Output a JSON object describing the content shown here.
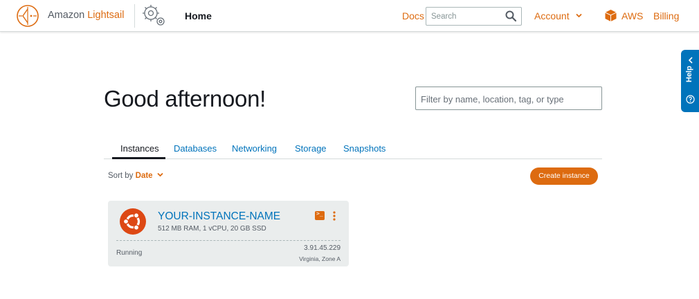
{
  "header": {
    "brand_prefix": "Amazon ",
    "brand_name": "Lightsail",
    "home_label": "Home",
    "docs_label": "Docs",
    "search_placeholder": "Search",
    "account_label": "Account",
    "aws_label": "AWS",
    "billing_label": "Billing",
    "accent_color": "#dd6b10"
  },
  "help_tab": {
    "label": "Help",
    "color": "#0073bb"
  },
  "main": {
    "greeting": "Good afternoon!",
    "filter_placeholder": "Filter by name, location, tag, or type",
    "tabs": [
      {
        "label": "Instances",
        "active": true
      },
      {
        "label": "Databases",
        "active": false
      },
      {
        "label": "Networking",
        "active": false
      },
      {
        "label": "Storage",
        "active": false
      },
      {
        "label": "Snapshots",
        "active": false
      }
    ],
    "sort_label": "Sort by",
    "sort_value": "Date",
    "create_button": "Create instance"
  },
  "instance": {
    "name": "YOUR-INSTANCE-NAME",
    "specs": "512 MB RAM, 1 vCPU, 20 GB SSD",
    "status": "Running",
    "ip": "3.91.45.229",
    "zone": "Virginia, Zone A",
    "os_icon": "ubuntu-icon"
  }
}
